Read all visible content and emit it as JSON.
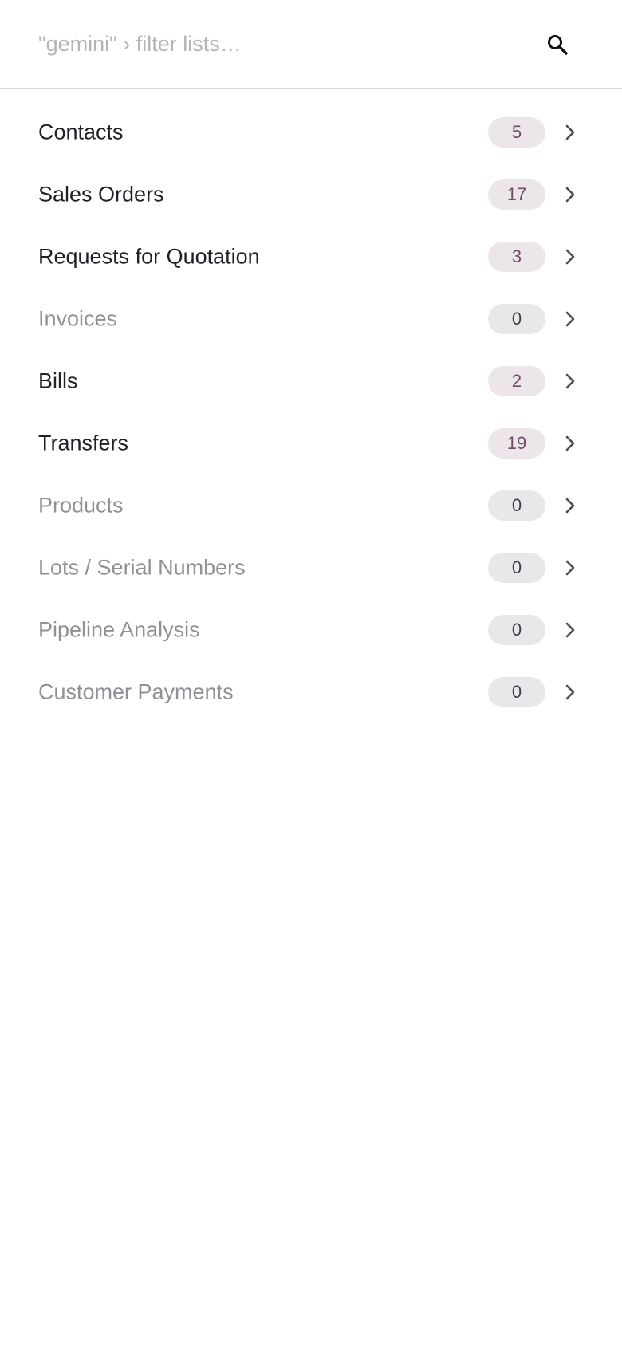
{
  "search": {
    "placeholder": "\"gemini\" › filter lists…",
    "value": ""
  },
  "icons": {
    "search": "search-icon",
    "chevron": "chevron-right-icon"
  },
  "colors": {
    "accent": "#714b67",
    "active_badge_bg": "#ece6ea",
    "empty_badge_bg": "#e8e8ea",
    "active_text": "#1f2126",
    "muted_text": "#8f9196"
  },
  "lists": [
    {
      "label": "Contacts",
      "count": "5"
    },
    {
      "label": "Sales Orders",
      "count": "17"
    },
    {
      "label": "Requests for Quotation",
      "count": "3"
    },
    {
      "label": "Invoices",
      "count": "0"
    },
    {
      "label": "Bills",
      "count": "2"
    },
    {
      "label": "Transfers",
      "count": "19"
    },
    {
      "label": "Products",
      "count": "0"
    },
    {
      "label": "Lots / Serial Numbers",
      "count": "0"
    },
    {
      "label": "Pipeline Analysis",
      "count": "0"
    },
    {
      "label": "Customer Payments",
      "count": "0"
    }
  ]
}
